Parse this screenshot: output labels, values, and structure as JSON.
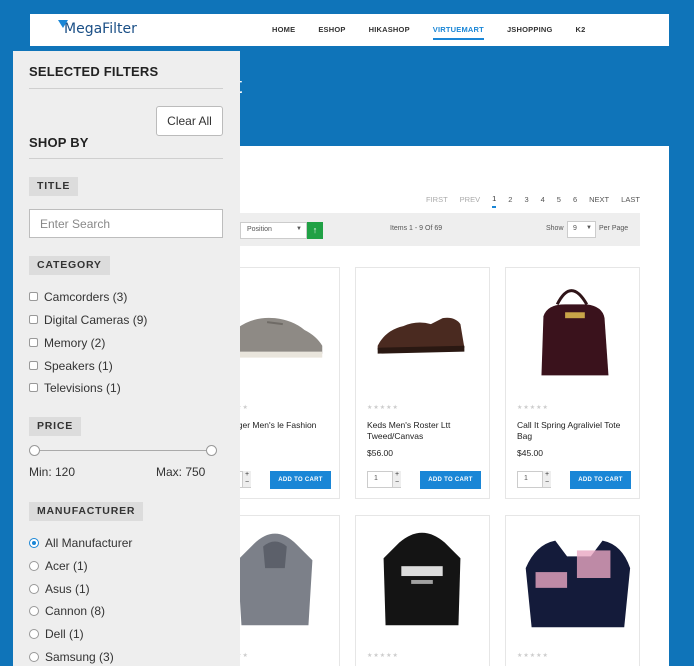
{
  "brand": {
    "logo_text": "MegaFilter",
    "accent": "#1a86d6",
    "background": "#0f74b9"
  },
  "nav": {
    "items": [
      {
        "label": "HOME",
        "active": false
      },
      {
        "label": "ESHOP",
        "active": false
      },
      {
        "label": "HIKASHOP",
        "active": false
      },
      {
        "label": "VIRTUEMART",
        "active": true
      },
      {
        "label": "JSHOPPING",
        "active": false
      },
      {
        "label": "K2",
        "active": false
      }
    ]
  },
  "hero": {
    "fragment": "t"
  },
  "pagination": {
    "first": "FIRST",
    "prev": "PREV",
    "pages": [
      "1",
      "2",
      "3",
      "4",
      "5",
      "6"
    ],
    "current": "1",
    "next": "NEXT",
    "last": "LAST"
  },
  "toolbar": {
    "sort_value": "Position",
    "sort_button": "↑",
    "items_info": "Items  1 - 9  Of  69",
    "show_label": "Show",
    "show_value": "9",
    "per_page": "Per Page"
  },
  "products": [
    {
      "name": "y Hilfiger Men's le Fashion",
      "price": "",
      "qty": "1",
      "add_label": "ADD TO CART",
      "image": "grey-sneaker"
    },
    {
      "name": "Keds Men's Roster Ltt Tweed/Canvas",
      "price": "$56.00",
      "qty": "1",
      "add_label": "ADD TO CART",
      "image": "brown-oxford-shoe"
    },
    {
      "name": "Call It Spring Agraliviel Tote Bag",
      "price": "$45.00",
      "qty": "1",
      "add_label": "ADD TO CART",
      "image": "leather-backpack"
    },
    {
      "name": "",
      "price": "",
      "image": "grey-knit-hoodie"
    },
    {
      "name": "",
      "price": "",
      "image": "black-oakley-hoodie"
    },
    {
      "name": "",
      "price": "",
      "image": "bts-sweatshirt"
    }
  ],
  "filters": {
    "selected_title": "SELECTED FILTERS",
    "clear_all": "Clear All",
    "shop_by": "SHOP BY",
    "title_section": {
      "label": "TITLE",
      "placeholder": "Enter Search"
    },
    "category": {
      "label": "CATEGORY",
      "options": [
        "Camcorders (3)",
        "Digital Cameras (9)",
        "Memory (2)",
        "Speakers (1)",
        "Televisions (1)"
      ]
    },
    "price": {
      "label": "PRICE",
      "min_text": "Min: 120",
      "max_text": "Max: 750",
      "min": 120,
      "max": 750
    },
    "manufacturer": {
      "label": "MANUFACTURER",
      "options": [
        "All Manufacturer",
        "Acer (1)",
        "Asus (1)",
        "Cannon (8)",
        "Dell (1)",
        "Samsung (3)"
      ],
      "selected": "All Manufacturer"
    }
  }
}
